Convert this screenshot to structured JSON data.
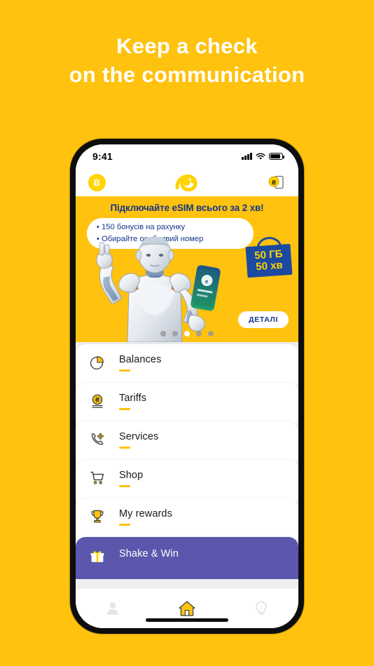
{
  "headline": {
    "line1": "Keep a check",
    "line2": "on the communication"
  },
  "colors": {
    "brand_yellow": "#FFC20E",
    "logo_yellow": "#FFD400",
    "brand_blue": "#15358C",
    "promo_purple": "#5B57AD",
    "white": "#FFFFFF"
  },
  "phone": {
    "statusbar": {
      "time": "9:41",
      "icons": [
        "cellular-signal-icon",
        "wifi-icon",
        "battery-icon"
      ]
    },
    "appbar": {
      "avatar_letter": "B",
      "logo_name": "beeline-logo",
      "wallet_icon_name": "wallet-topup-icon"
    },
    "banner": {
      "title": "Підключайте eSIM всього за 2 хв!",
      "bullets": [
        "• 150 бонусів на рахунку",
        "• Обирайте особливий номер"
      ],
      "gift": {
        "line1": "50 ГБ",
        "line2": "50 хв"
      },
      "cta_label": "ДЕТАЛІ",
      "dots_total": 5,
      "dots_active_index": 2
    },
    "menu": [
      {
        "label": "Balances",
        "icon": "pie-chart-icon"
      },
      {
        "label": "Tariffs",
        "icon": "hryvnia-coin-icon"
      },
      {
        "label": "Services",
        "icon": "phone-plus-icon"
      },
      {
        "label": "Shop",
        "icon": "shopping-cart-icon"
      },
      {
        "label": "My rewards",
        "icon": "trophy-icon"
      }
    ],
    "promo": {
      "label": "Shake & Win",
      "icon": "gift-icon"
    },
    "tabbar": [
      {
        "name": "profile",
        "icon": "person-icon",
        "active": false
      },
      {
        "name": "home",
        "icon": "house-icon",
        "active": true
      },
      {
        "name": "info",
        "icon": "lightbulb-icon",
        "active": false
      }
    ]
  }
}
